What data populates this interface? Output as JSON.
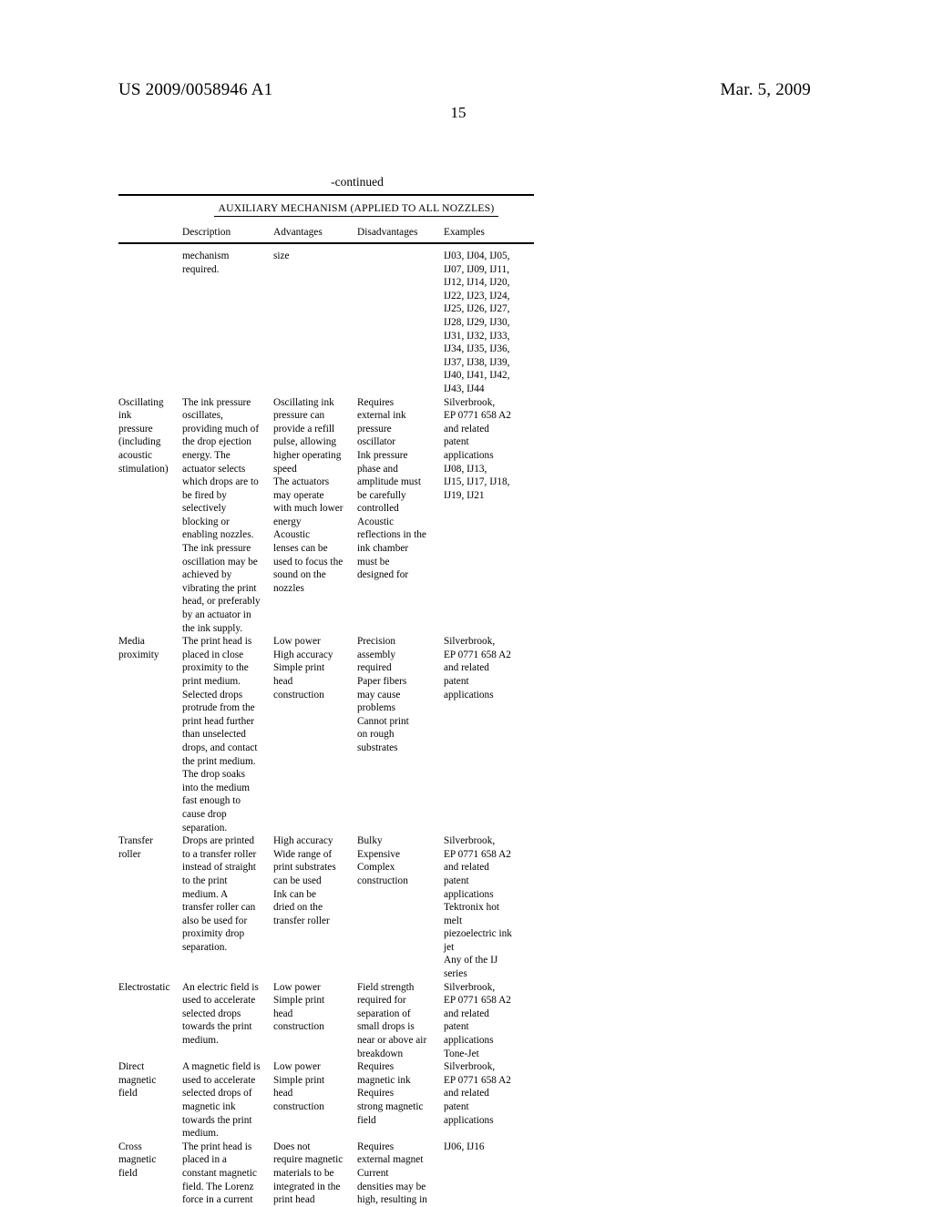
{
  "header": {
    "publication_number": "US 2009/0058946 A1",
    "publication_date": "Mar. 5, 2009",
    "page_number": "15"
  },
  "table": {
    "continued_label": "-continued",
    "title": "AUXILIARY MECHANISM (APPLIED TO ALL NOZZLES)",
    "columns": [
      {
        "key": "label",
        "header": ""
      },
      {
        "key": "description",
        "header": "Description"
      },
      {
        "key": "advantages",
        "header": "Advantages"
      },
      {
        "key": "disadvantages",
        "header": "Disadvantages"
      },
      {
        "key": "examples",
        "header": "Examples"
      }
    ],
    "rows": [
      {
        "label": "",
        "description": "mechanism\nrequired.",
        "advantages": "size",
        "disadvantages": "",
        "examples": "IJ03, IJ04, IJ05,\nIJ07, IJ09, IJ11,\nIJ12, IJ14, IJ20,\nIJ22, IJ23, IJ24,\nIJ25, IJ26, IJ27,\nIJ28, IJ29, IJ30,\nIJ31, IJ32, IJ33,\nIJ34, IJ35, IJ36,\nIJ37, IJ38, IJ39,\nIJ40, IJ41, IJ42,\nIJ43, IJ44"
      },
      {
        "label": "Oscillating\nink\npressure\n(including\nacoustic\nstimulation)",
        "description": "The ink pressure\noscillates,\nproviding much of\nthe drop ejection\nenergy. The\nactuator selects\nwhich drops are to\nbe fired by\nselectively\nblocking or\nenabling nozzles.\nThe ink pressure\noscillation may be\nachieved by\nvibrating the print\nhead, or preferably\nby an actuator in\nthe ink supply.",
        "advantages": "Oscillating ink\npressure can\nprovide a refill\npulse, allowing\nhigher operating\nspeed\nThe actuators\nmay operate\nwith much lower\nenergy\nAcoustic\nlenses can be\nused to focus the\nsound on the\nnozzles",
        "disadvantages": "Requires\nexternal ink\npressure\noscillator\nInk pressure\nphase and\namplitude must\nbe carefully\ncontrolled\nAcoustic\nreflections in the\nink chamber\nmust be\ndesigned for",
        "examples": "Silverbrook,\nEP 0771 658 A2\nand related\npatent\napplications\nIJ08, IJ13,\nIJ15, IJ17, IJ18,\nIJ19, IJ21"
      },
      {
        "label": "Media\nproximity",
        "description": "The print head is\nplaced in close\nproximity to the\nprint medium.\nSelected drops\nprotrude from the\nprint head further\nthan unselected\ndrops, and contact\nthe print medium.\nThe drop soaks\ninto the medium\nfast enough to\ncause drop\nseparation.",
        "advantages": "Low power\nHigh accuracy\nSimple print\nhead\nconstruction",
        "disadvantages": "Precision\nassembly\nrequired\nPaper fibers\nmay cause\nproblems\nCannot print\non rough\nsubstrates",
        "examples": "Silverbrook,\nEP 0771 658 A2\nand related\npatent\napplications"
      },
      {
        "label": "Transfer\nroller",
        "description": "Drops are printed\nto a transfer roller\ninstead of straight\nto the print\nmedium. A\ntransfer roller can\nalso be used for\nproximity drop\nseparation.",
        "advantages": "High accuracy\nWide range of\nprint substrates\ncan be used\nInk can be\ndried on the\ntransfer roller",
        "disadvantages": "Bulky\nExpensive\nComplex\nconstruction",
        "examples": "Silverbrook,\nEP 0771 658 A2\nand related\npatent\napplications\nTektronix hot\nmelt\npiezoelectric ink\njet\nAny of the IJ\nseries"
      },
      {
        "label": "Electrostatic",
        "description": "An electric field is\nused to accelerate\nselected drops\ntowards the print\nmedium.",
        "advantages": "Low power\nSimple print\nhead\nconstruction",
        "disadvantages": "Field strength\nrequired for\nseparation of\nsmall drops is\nnear or above air\nbreakdown",
        "examples": "Silverbrook,\nEP 0771 658 A2\nand related\npatent\napplications\nTone-Jet"
      },
      {
        "label": "Direct\nmagnetic\nfield",
        "description": "A magnetic field is\nused to accelerate\nselected drops of\nmagnetic ink\ntowards the print\nmedium.",
        "advantages": "Low power\nSimple print\nhead\nconstruction",
        "disadvantages": "Requires\nmagnetic ink\nRequires\nstrong magnetic\nfield",
        "examples": "Silverbrook,\nEP 0771 658 A2\nand related\npatent\napplications"
      },
      {
        "label": "Cross\nmagnetic\nfield",
        "description": "The print head is\nplaced in a\nconstant magnetic\nfield. The Lorenz\nforce in a current",
        "advantages": "Does not\nrequire magnetic\nmaterials to be\nintegrated in the\nprint head",
        "disadvantages": "Requires\nexternal magnet\nCurrent\ndensities may be\nhigh, resulting in",
        "examples": "IJ06, IJ16"
      }
    ]
  }
}
